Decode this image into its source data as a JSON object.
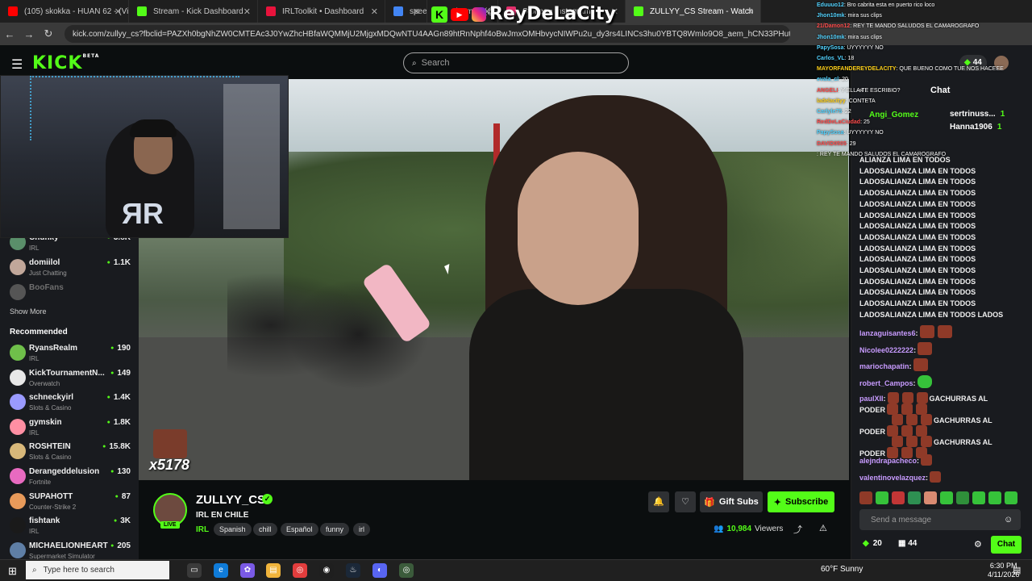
{
  "browser": {
    "tabs": [
      {
        "label": "(105) skokka - HUAN 62 - (Vide",
        "color": "#ff0000"
      },
      {
        "label": "Stream - Kick Dashboard",
        "color": "#53fc18"
      },
      {
        "label": "IRLToolkit • Dashboard",
        "color": "#e8133c"
      },
      {
        "label": "speed t",
        "color": "#4285f4"
      },
      {
        "label": "uizamon (@iibss.ju",
        "color": "#888888"
      },
      {
        "label": "Stories • Instagram",
        "color": "#e1306c"
      },
      {
        "label": "ZULLYY_CS Stream - Watch",
        "color": "#53fc18"
      }
    ],
    "url": "kick.com/zullyy_cs?fbclid=PAZXh0bgNhZW0CMTEAc3J0YwZhcHBfaWQMMjU2MjgxMDQwNTU4AAGn89htRnNphf4oBwJmxOMHbvycNIWPu2u_dy3rs4LINCs3hu0YBTQ8Wmlo9O8_aem_hCN33PHuto3BGeoDOmE2Aw"
  },
  "kick": {
    "logo": "KICK",
    "logo_sup": "BETA",
    "search_placeholder": "Search"
  },
  "overlay": {
    "brand": "ReyDeLaCity",
    "gift_count": "x5178",
    "chat": [
      {
        "user": "Eduuuo12",
        "msg": ": Bro cabrita esta en puerto rico loco",
        "cls": ""
      },
      {
        "user": "Jhon10mk",
        "msg": ": mira sus clips",
        "cls": ""
      },
      {
        "user": "21/Damon12",
        "msg": ": REY TE MANDO SALUDOS EL CAMAROGRAFO",
        "cls": "r"
      },
      {
        "user": "Jhon10mk",
        "msg": ": mira sus clips",
        "cls": ""
      },
      {
        "user": "PapySosa",
        "msg": ": UYYYYYY NO",
        "cls": ""
      },
      {
        "user": "Carlos_VL",
        "msg": ": 18",
        "cls": ""
      },
      {
        "user": "MAYORFANDEREYDELACITY",
        "msg": ": QUE BUENO COMO TUE NOS HACEEE",
        "cls": "y"
      },
      {
        "user": "evala_cl",
        "msg": ": 20",
        "cls": ""
      },
      {
        "user": "ANGELI",
        "msg": ": Y ELLA TE ESCRIBIO?",
        "cls": "r"
      },
      {
        "user": "ladelacityy",
        "msg": ": CONTETA",
        "cls": "y"
      },
      {
        "user": "Carlyle75",
        "msg": ": 22",
        "cls": ""
      },
      {
        "user": "RedDeLaCiudad",
        "msg": ": 25",
        "cls": "r"
      },
      {
        "user": "PapySosa",
        "msg": ": UYYYYYY NO",
        "cls": ""
      },
      {
        "user": "DAVID0505",
        "msg": ": 29",
        "cls": "r"
      },
      {
        "user": "",
        "msg": ": REY TE MANDO SALUDOS EL CAMAROGRAFO",
        "cls": ""
      }
    ]
  },
  "sidebar": {
    "following": [
      {
        "name": "Chunky",
        "category": "IRL",
        "viewers": "3.8K",
        "color": "#5a8f6a",
        "muted": false
      },
      {
        "name": "domiilol",
        "category": "Just Chatting",
        "viewers": "1.1K",
        "color": "#c1a79a",
        "muted": false
      },
      {
        "name": "BooFans",
        "category": "",
        "viewers": "",
        "color": "#555555",
        "muted": true
      }
    ],
    "show_more": "Show More",
    "recommended_label": "Recommended",
    "recommended": [
      {
        "name": "RyansRealm",
        "category": "IRL",
        "viewers": "190",
        "color": "#6fbf4a"
      },
      {
        "name": "KickTournamentN...",
        "category": "Overwatch",
        "viewers": "149",
        "color": "#e8e8e8"
      },
      {
        "name": "schneckyirl",
        "category": "Slots & Casino",
        "viewers": "1.4K",
        "color": "#9a9aff"
      },
      {
        "name": "gymskin",
        "category": "IRL",
        "viewers": "1.8K",
        "color": "#ff8fa3"
      },
      {
        "name": "ROSHTEIN",
        "category": "Slots & Casino",
        "viewers": "15.8K",
        "color": "#d8b87a"
      },
      {
        "name": "Derangeddelusion",
        "category": "Fortnite",
        "viewers": "130",
        "color": "#e86ac0"
      },
      {
        "name": "SUPAHOTT",
        "category": "Counter-Strike 2",
        "viewers": "87",
        "color": "#e89a5a"
      },
      {
        "name": "fishtank",
        "category": "IRL",
        "viewers": "3K",
        "color": "#1a1a1a"
      },
      {
        "name": "MICHAELIONHEART",
        "category": "Supermarket Simulator",
        "viewers": "205",
        "color": "#5f7fa6"
      }
    ]
  },
  "stream": {
    "channel": "ZULLYY_CS",
    "live": "LIVE",
    "title": "IRL EN CHILE",
    "category": "IRL",
    "tags": [
      "Spanish",
      "chill",
      "Español",
      "funny",
      "irl"
    ],
    "gift_subs": "Gift Subs",
    "subscribe": "Subscribe",
    "viewers": "10,984",
    "viewers_label": "Viewers"
  },
  "chat": {
    "count": "44",
    "heading": "Chat",
    "top_gifters": [
      {
        "name": "sertrinuss...",
        "count": "1"
      },
      {
        "name": "Hanna1906",
        "count": "1"
      }
    ],
    "top_gifter_single": "Angi_Gomez",
    "lines": [
      {
        "user": "",
        "text": "ALIANZA LIMA EN TODOS"
      },
      {
        "user": "",
        "text": "LADOSALIANZA LIMA EN TODOS"
      },
      {
        "user": "",
        "text": "LADOSALIANZA LIMA EN TODOS"
      },
      {
        "user": "",
        "text": "LADOSALIANZA LIMA EN TODOS"
      },
      {
        "user": "",
        "text": "LADOSALIANZA LIMA EN TODOS"
      },
      {
        "user": "",
        "text": "LADOSALIANZA LIMA EN TODOS"
      },
      {
        "user": "",
        "text": "LADOSALIANZA LIMA EN TODOS"
      },
      {
        "user": "",
        "text": "LADOSALIANZA LIMA EN TODOS"
      },
      {
        "user": "",
        "text": "LADOSALIANZA LIMA EN TODOS"
      },
      {
        "user": "",
        "text": "LADOSALIANZA LIMA EN TODOS"
      },
      {
        "user": "",
        "text": "LADOSALIANZA LIMA EN TODOS"
      },
      {
        "user": "",
        "text": "LADOSALIANZA LIMA EN TODOS"
      },
      {
        "user": "",
        "text": "LADOSALIANZA LIMA EN TODOS"
      },
      {
        "user": "",
        "text": "LADOSALIANZA LIMA EN TODOS"
      },
      {
        "user": "",
        "text": "LADOSALIANZA LIMA EN TODOS LADOS"
      }
    ],
    "emote_msgs": [
      {
        "user": "lanzaguisantes6",
        "text": "",
        "emotes": 2,
        "green": false
      },
      {
        "user": "Nicolee0222222",
        "text": "",
        "emotes": 1,
        "green": false
      },
      {
        "user": "mariochapatin",
        "text": "",
        "emotes": 1,
        "green": false
      },
      {
        "user": "robert_Campos",
        "text": "",
        "emotes": 1,
        "green": true
      }
    ],
    "gachurras_user": "paulXII",
    "gachurras_lines": [
      "GACHURRAS AL",
      "PODER",
      "GACHURRAS AL",
      "PODER",
      "GACHURRAS AL",
      "PODER"
    ],
    "after_msgs": [
      {
        "user": "alejndrapacheco",
        "text": ""
      },
      {
        "user": "valentinovelazquez",
        "text": ""
      }
    ],
    "send_placeholder": "Send a message",
    "footer_points": "20",
    "footer_count": "44",
    "send_button": "Chat"
  },
  "taskbar": {
    "search_placeholder": "Type here to search",
    "weather": "60°F  Sunny",
    "time": "6:30 PM",
    "date": "4/11/2026"
  }
}
